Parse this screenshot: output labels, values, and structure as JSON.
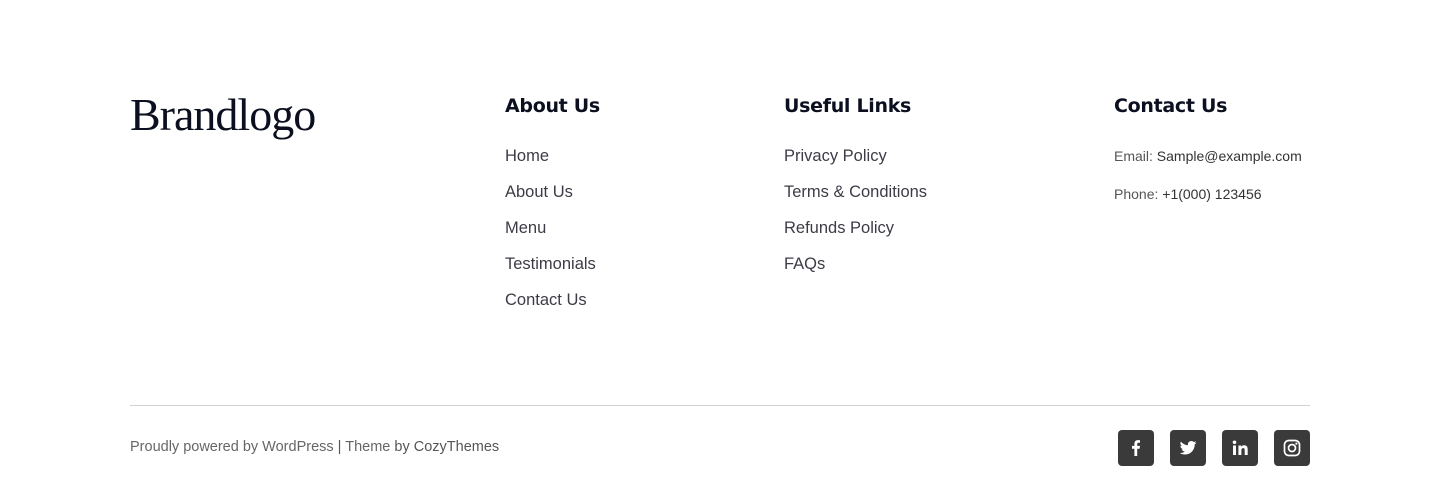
{
  "brand": {
    "logo_text": "Brandlogo"
  },
  "about": {
    "heading": "About Us",
    "links": [
      "Home",
      "About Us",
      "Menu",
      "Testimonials",
      "Contact Us"
    ]
  },
  "useful": {
    "heading": "Useful Links",
    "links": [
      "Privacy Policy",
      "Terms & Conditions",
      "Refunds Policy",
      "FAQs"
    ]
  },
  "contact": {
    "heading": "Contact Us",
    "email_label": "Email:",
    "email_value": "Sample@example.com",
    "phone_label": "Phone:",
    "phone_value": "+1(000) 123456"
  },
  "footer": {
    "powered_text": "Proudly powered by WordPress",
    "separator": "|",
    "theme_text": "Theme",
    "author_text": "by CozyThemes"
  },
  "social": {
    "icon_color": "#3a3a3a",
    "icons": [
      "facebook-icon",
      "twitter-icon",
      "linkedin-icon",
      "instagram-icon"
    ]
  }
}
